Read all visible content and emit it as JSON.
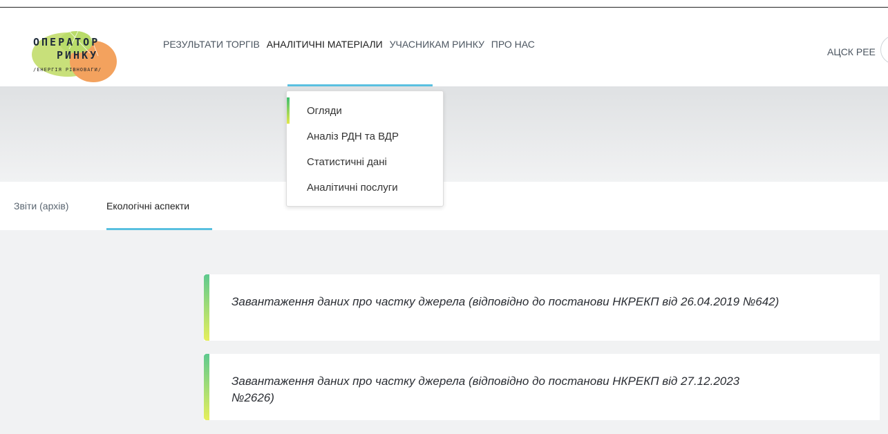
{
  "logo": {
    "line1": "ОПЕРАТОР",
    "line2": "РИНКУ",
    "tagline": "/ЕНЕРГІЯ РІВНОВАГИ/"
  },
  "nav": {
    "items": [
      {
        "label": "РЕЗУЛЬТАТИ ТОРГІВ"
      },
      {
        "label": "АНАЛІТИЧНІ МАТЕРІАЛИ"
      },
      {
        "label": "УЧАСНИКАМ РИНКУ"
      },
      {
        "label": "ПРО НАС"
      }
    ],
    "active_index": 1,
    "right_link": "АЦСК РЕЕ"
  },
  "dropdown": {
    "items": [
      {
        "label": "Огляди"
      },
      {
        "label": "Аналіз РДН та ВДР"
      },
      {
        "label": "Статистичні дані"
      },
      {
        "label": "Аналітичні послуги"
      }
    ]
  },
  "tabs": [
    {
      "label": "Звіти (архів)"
    },
    {
      "label": "Екологічні аспекти"
    }
  ],
  "cards": [
    {
      "title": "Завантаження даних про частку джерела (відповідно до постанови НКРЕКП від 26.04.2019 №642)"
    },
    {
      "title": "Завантаження даних про частку джерела (відповідно до постанови НКРЕКП від 27.12.2023 №2626)"
    }
  ],
  "colors": {
    "accent": "#59c0e0",
    "card_bar_top": "#5ec98e",
    "card_bar_bottom": "#e6ef5c",
    "logo_blob_green": "#c8e07a",
    "logo_blob_orange": "#f3a25e"
  }
}
